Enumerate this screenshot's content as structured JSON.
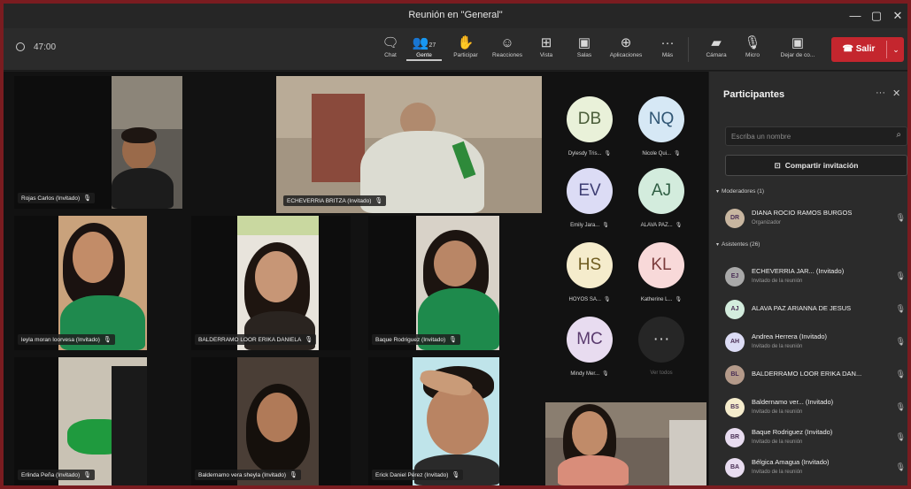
{
  "window": {
    "title": "Reunión en \"General\"",
    "minimize": "—",
    "maximize": "▢",
    "close": "✕"
  },
  "toolbar": {
    "timer": "47:00",
    "items": [
      {
        "label": "Chat",
        "icon": "chat-icon",
        "glyph": "💬"
      },
      {
        "label": "Gente",
        "icon": "people-icon",
        "glyph": "👥",
        "badge": "27"
      },
      {
        "label": "Participar",
        "icon": "raise-hand-icon",
        "glyph": "✋"
      },
      {
        "label": "Reacciones",
        "icon": "reactions-icon",
        "glyph": "☺"
      },
      {
        "label": "Vista",
        "icon": "view-icon",
        "glyph": "⊞"
      },
      {
        "label": "Salas",
        "icon": "breakout-rooms-icon",
        "glyph": "▣"
      },
      {
        "label": "Aplicaciones",
        "icon": "apps-icon",
        "glyph": "⊕"
      },
      {
        "label": "Más",
        "icon": "more-icon",
        "glyph": "···"
      },
      {
        "label": "Cámara",
        "icon": "camera-icon",
        "glyph": "■"
      },
      {
        "label": "Micro",
        "icon": "microphone-icon",
        "glyph": "🎤"
      },
      {
        "label": "Dejar de co...",
        "icon": "stop-sharing-icon",
        "glyph": "▣"
      }
    ],
    "leave_label": "☎ Salir",
    "leave_caret": "⌄"
  },
  "stage": {
    "tiles": [
      {
        "name": "Rojas Carlos (Invitado)"
      },
      {
        "name": "ECHEVERRIA BRITZA (Invitado)"
      },
      {
        "name": "leyla moran loorvesa (Invitado)"
      },
      {
        "name": "BALDERRAMO LOOR ERIKA DANIELA"
      },
      {
        "name": "Baque Rodriguez (Invitado)"
      },
      {
        "name": "Erlinda Peña (Invitado)"
      },
      {
        "name": "Baldernamo vera sheyla (Invitado)"
      },
      {
        "name": "Erick Daniel Pérez (Invitado)"
      }
    ],
    "avatars": [
      {
        "initials": "DB",
        "name": "Dylesdy Tris...",
        "bg": "#e9f1d9",
        "fg": "#4b5e3a"
      },
      {
        "initials": "NQ",
        "name": "Nicole Qui...",
        "bg": "#d6e8f5",
        "fg": "#2f5573"
      },
      {
        "initials": "EV",
        "name": "Emily Jara...",
        "bg": "#dcdcf5",
        "fg": "#3e3e73"
      },
      {
        "initials": "AJ",
        "name": "ALAVA PAZ...",
        "bg": "#d3ecdd",
        "fg": "#2f5e43"
      },
      {
        "initials": "HS",
        "name": "HOYOS SA...",
        "bg": "#f5eccc",
        "fg": "#6e5b1f"
      },
      {
        "initials": "KL",
        "name": "Katherine L...",
        "bg": "#f8d9d9",
        "fg": "#7a3b3b"
      },
      {
        "initials": "MC",
        "name": "Mindy Mer...",
        "bg": "#e8dcf0",
        "fg": "#5a3b6e"
      },
      {
        "initials": "···",
        "name": "Ver todos",
        "bg": "#262626",
        "fg": "#cfcfcf"
      }
    ]
  },
  "panel": {
    "title": "Participantes",
    "search_placeholder": "Escriba un nombre",
    "invite_label": "Compartir invitación",
    "moderators_label": "Moderadores (1)",
    "attendees_label": "Asistentes (26)",
    "moderators": [
      {
        "name": "DIANA ROCIO RAMOS BURGOS",
        "role": "Organizador",
        "initials": "DR",
        "bg": "#c8b6a0"
      }
    ],
    "attendees": [
      {
        "name": "ECHEVERRIA JAR... (Invitado)",
        "sub": "Invitado de la reunión",
        "initials": "EJ",
        "bg": "#a9a9a9"
      },
      {
        "name": "ALAVA PAZ ARIANNA DE JESUS",
        "sub": "",
        "initials": "AJ",
        "bg": "#d3ecdd"
      },
      {
        "name": "Andrea Herrera (Invitado)",
        "sub": "Invitado de la reunión",
        "initials": "AH",
        "bg": "#dcdcf5"
      },
      {
        "name": "BALDERRAMO LOOR ERIKA DAN...",
        "sub": "",
        "initials": "BL",
        "bg": "#b49a8a"
      },
      {
        "name": "Baldernamo ver... (Invitado)",
        "sub": "Invitado de la reunión",
        "initials": "BS",
        "bg": "#f5eccc"
      },
      {
        "name": "Baque Rodriguez (Invitado)",
        "sub": "Invitado de la reunión",
        "initials": "BR",
        "bg": "#e8dcf0"
      },
      {
        "name": "Bélgica Amagua (Invitado)",
        "sub": "Invitado de la reunión",
        "initials": "BA",
        "bg": "#e8dcf0"
      }
    ]
  }
}
